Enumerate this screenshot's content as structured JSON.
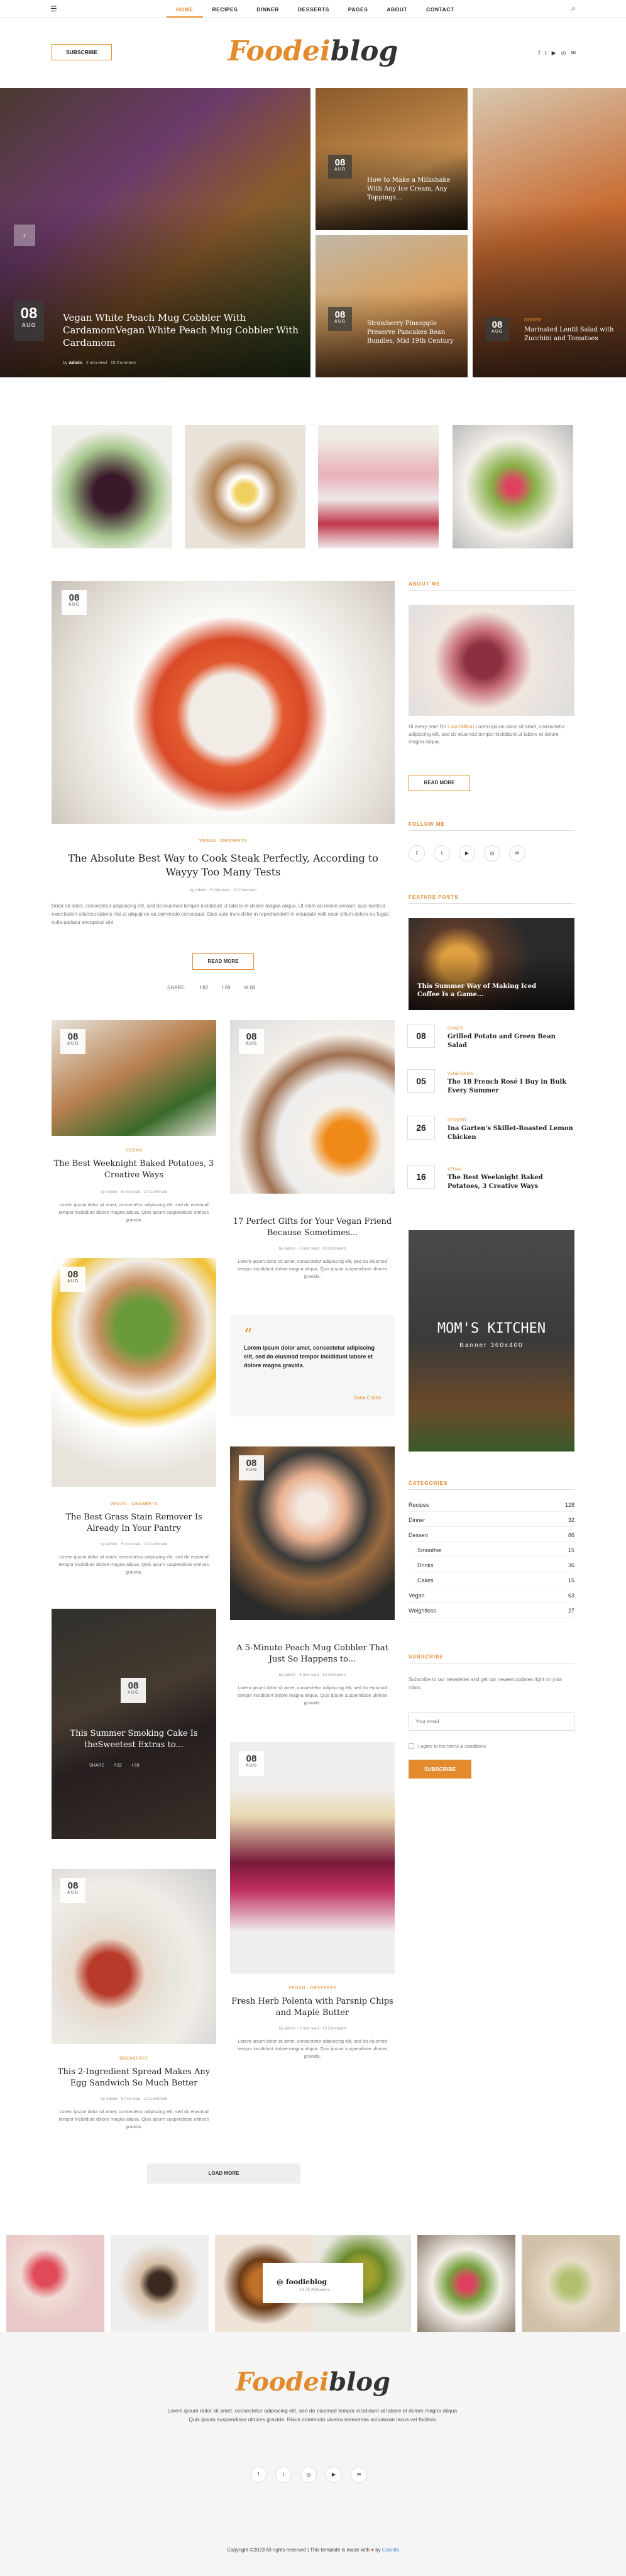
{
  "nav": {
    "items": [
      "HOME",
      "RECIPES",
      "DINNER",
      "DESSERTS",
      "PAGES",
      "ABOUT",
      "CONTACT"
    ]
  },
  "header": {
    "subscribe": "SUBSCRIBE",
    "logo_a": "Foodei",
    "logo_b": "blog",
    "socials": [
      "f",
      "t",
      "▶",
      "◎",
      "✉"
    ]
  },
  "hero": {
    "main": {
      "day": "08",
      "month": "AUG",
      "title": "Vegan White Peach Mug Cobbler With CardamomVegan White Peach Mug Cobbler With Cardamom",
      "author": "Admin",
      "read": "2 min read",
      "comments": "10 Comment"
    },
    "top": {
      "day": "08",
      "month": "AUG",
      "title": "How to Make a Milkshake With Any Ice Cream, Any Toppings..."
    },
    "bottom": {
      "day": "08",
      "month": "AUG",
      "title": "Strawberry Pineapple Preserve Pancakes Bean Bundles, Mid 19th Century"
    },
    "right": {
      "day": "08",
      "month": "AUG",
      "cat": "DINNER",
      "title": "Marinated Lentil Salad with Zucchini and Tomatoes"
    }
  },
  "featured": {
    "day": "08",
    "month": "AUG",
    "cats": "VEGAN · DESSERTS",
    "title": "The Absolute Best Way to Cook Steak Perfectly, According to Wayyy Too Many Tests",
    "meta": "by Admin · 5 min read · 10 Comment",
    "excerpt": "Dolor sit amet, consectetur adipisicing elit, sed do eiusmod tempor incididunt ut labore et dolore magna aliqua. Ut enim ad minim veniam, quis nostrud exercitation ullamco laboris nisi ut aliquip ex ea commodo consequat. Duis aute irure dolor in reprehenderit in voluptate velit esse cillum dolore eu fugiat nulla pariatur excepteur sint",
    "readmore": "READ MORE",
    "share": "SHARE:",
    "fb": "82",
    "tw": "59",
    "mail": "08"
  },
  "posts": [
    {
      "cat": "VEGAN",
      "title": "The Best Weeknight Baked Potatoes, 3 Creative Ways",
      "meta": "by Admin · 5 min read · 10 Comment",
      "ex": "Lorem ipsum dolor sit amet, consectetur adipiscing elit, sed do eiusmod tempor incididunt dolore magna aliqua. Quis ipsum suspendisse ultrices gravida."
    },
    {
      "cat": "VEGAN · DESSERTS",
      "title": "The Best Grass Stain Remover Is Already In Your Pantry",
      "meta": "by Admin · 5 min read · 10 Comment",
      "ex": "Lorem ipsum dolor sit amet, consectetur adipiscing elit, sed do eiusmod tempor incididunt dolore magna aliqua. Quis ipsum suspendisse ultrices gravida."
    },
    {
      "cat": "BREAKFAST",
      "title": "This 2-Ingredient Spread Makes Any Egg Sandwich So Much Better",
      "meta": "by Admin · 5 min read · 10 Comment",
      "ex": "Lorem ipsum dolor sit amet, consectetur adipiscing elit, sed do eiusmod tempor incididunt dolore magna aliqua. Quis ipsum suspendisse ultrices gravida."
    },
    {
      "cat": "",
      "title": "17 Perfect Gifts for Your Vegan Friend Because Sometimes...",
      "meta": "by Admin · 5 min read · 10 Comment",
      "ex": "Lorem ipsum dolor sit amet, consectetur adipiscing elit, sed do eiusmod tempor incididunt dolore magna aliqua. Quis ipsum suspendisse ultrices gravida."
    },
    {
      "cat": "",
      "title": "A 5-Minute Peach Mug Cobbler That Just So Happens to...",
      "meta": "by Admin · 5 min read · 10 Comment",
      "ex": "Lorem ipsum dolor sit amet, consectetur adipiscing elit, sed do eiusmod tempor incididunt dolore magna aliqua. Quis ipsum suspendisse ultrices gravida."
    },
    {
      "cat": "VEGAN · DESSERTS",
      "title": "Fresh Herb Polenta with Parsnip Chips and Maple Butter",
      "meta": "by Admin · 5 min read · 10 Comment",
      "ex": "Lorem ipsum dolor sit amet, consectetur adipiscing elit, sed do eiusmod tempor incididunt dolore magna aliqua. Quis ipsum suspendisse ultrices gravida."
    }
  ],
  "dark_post": {
    "day": "08",
    "month": "AUG",
    "title": "This Summer Smoking Cake Is theSweetest Extras to...",
    "share": "SHARE",
    "fb": "82",
    "tw": "59"
  },
  "quote": {
    "mark": "“",
    "text": "Lorem ipsum dolor amet, consectetur adipiscing elit, sed do eiusmod tempor incididunt labore et dolore magna gravida.",
    "author": "Dana Colins"
  },
  "date_badge": {
    "day": "08",
    "month": "AUG"
  },
  "loadmore": "LOAD MORE",
  "sidebar": {
    "about_title": "ABOUT ME",
    "about_text_a": "Hi every one! I'm",
    "about_name": "Lora Hillson",
    "about_text_b": "Lorem ipsum dolor sit amet, consectetur adipiscing elit, sed do eiusmod tempor incididunt ut labore et dolore magna aliqua.",
    "about_btn": "READ MORE",
    "follow_title": "FOLLOW ME",
    "follow": [
      "f",
      "t",
      "▶",
      "◎",
      "✉"
    ],
    "feat_title": "FEATURE POSTS",
    "feat_main": "This Summer Way of Making Iced Coffee Is a Game...",
    "feat_list": [
      {
        "num": "08",
        "cat": "DINNER",
        "title": "Grilled Potato and Green Bean Salad"
      },
      {
        "num": "05",
        "cat": "VEGETARIAN",
        "title": "The 18 French Rosé I Buy in Bulk Every Summer"
      },
      {
        "num": "26",
        "cat": "DESSERT",
        "title": "Ina Garten's Skillet-Roasted Lemon Chicken"
      },
      {
        "num": "16",
        "cat": "VEGAN",
        "title": "The Best Weeknight Baked Potatoes, 3 Creative Ways"
      }
    ],
    "banner_brand": "MOM'S KITCHEN",
    "banner_size": "Banner 360x400",
    "cat_title": "CATEGORIES",
    "cats": [
      {
        "name": "Recipes",
        "count": "128"
      },
      {
        "name": "Dinner",
        "count": "32"
      },
      {
        "name": "Dessert",
        "count": "86"
      },
      {
        "name": "Smoothie",
        "count": "15"
      },
      {
        "name": "Drinks",
        "count": "36"
      },
      {
        "name": "Cakes",
        "count": "15"
      },
      {
        "name": "Vegan",
        "count": "63"
      },
      {
        "name": "Weightloss",
        "count": "27"
      }
    ],
    "subs_title": "SUBSCRIBE",
    "subs_text": "Subscribe to our newsletter and get our newest updates right on your inbox.",
    "subs_placeholder": "Your email",
    "subs_agree": "I agree to the terms & conditions",
    "subs_btn": "SUBSCRIBE"
  },
  "insta": {
    "handle": "@ foodieblog",
    "followers": "13.7k Followers"
  },
  "footer": {
    "logo_a": "Foodei",
    "logo_b": "blog",
    "text": "Lorem ipsum dolor sit amet, consectetur adipiscing elit, sed do eiusmod tempor incididunt ut labore et dolore magna aliqua. Quis ipsum suspendisse ultrices gravida. Risus commodo viverra maecenas accumsan lacus vel facilisis.",
    "socials": [
      "f",
      "t",
      "◎",
      "▶",
      "✉"
    ],
    "copy_a": "Copyright ©2023 All rights reserved | This template is made with",
    "copy_heart": "♥",
    "copy_b": "by",
    "copy_brand": "Colorlib"
  }
}
